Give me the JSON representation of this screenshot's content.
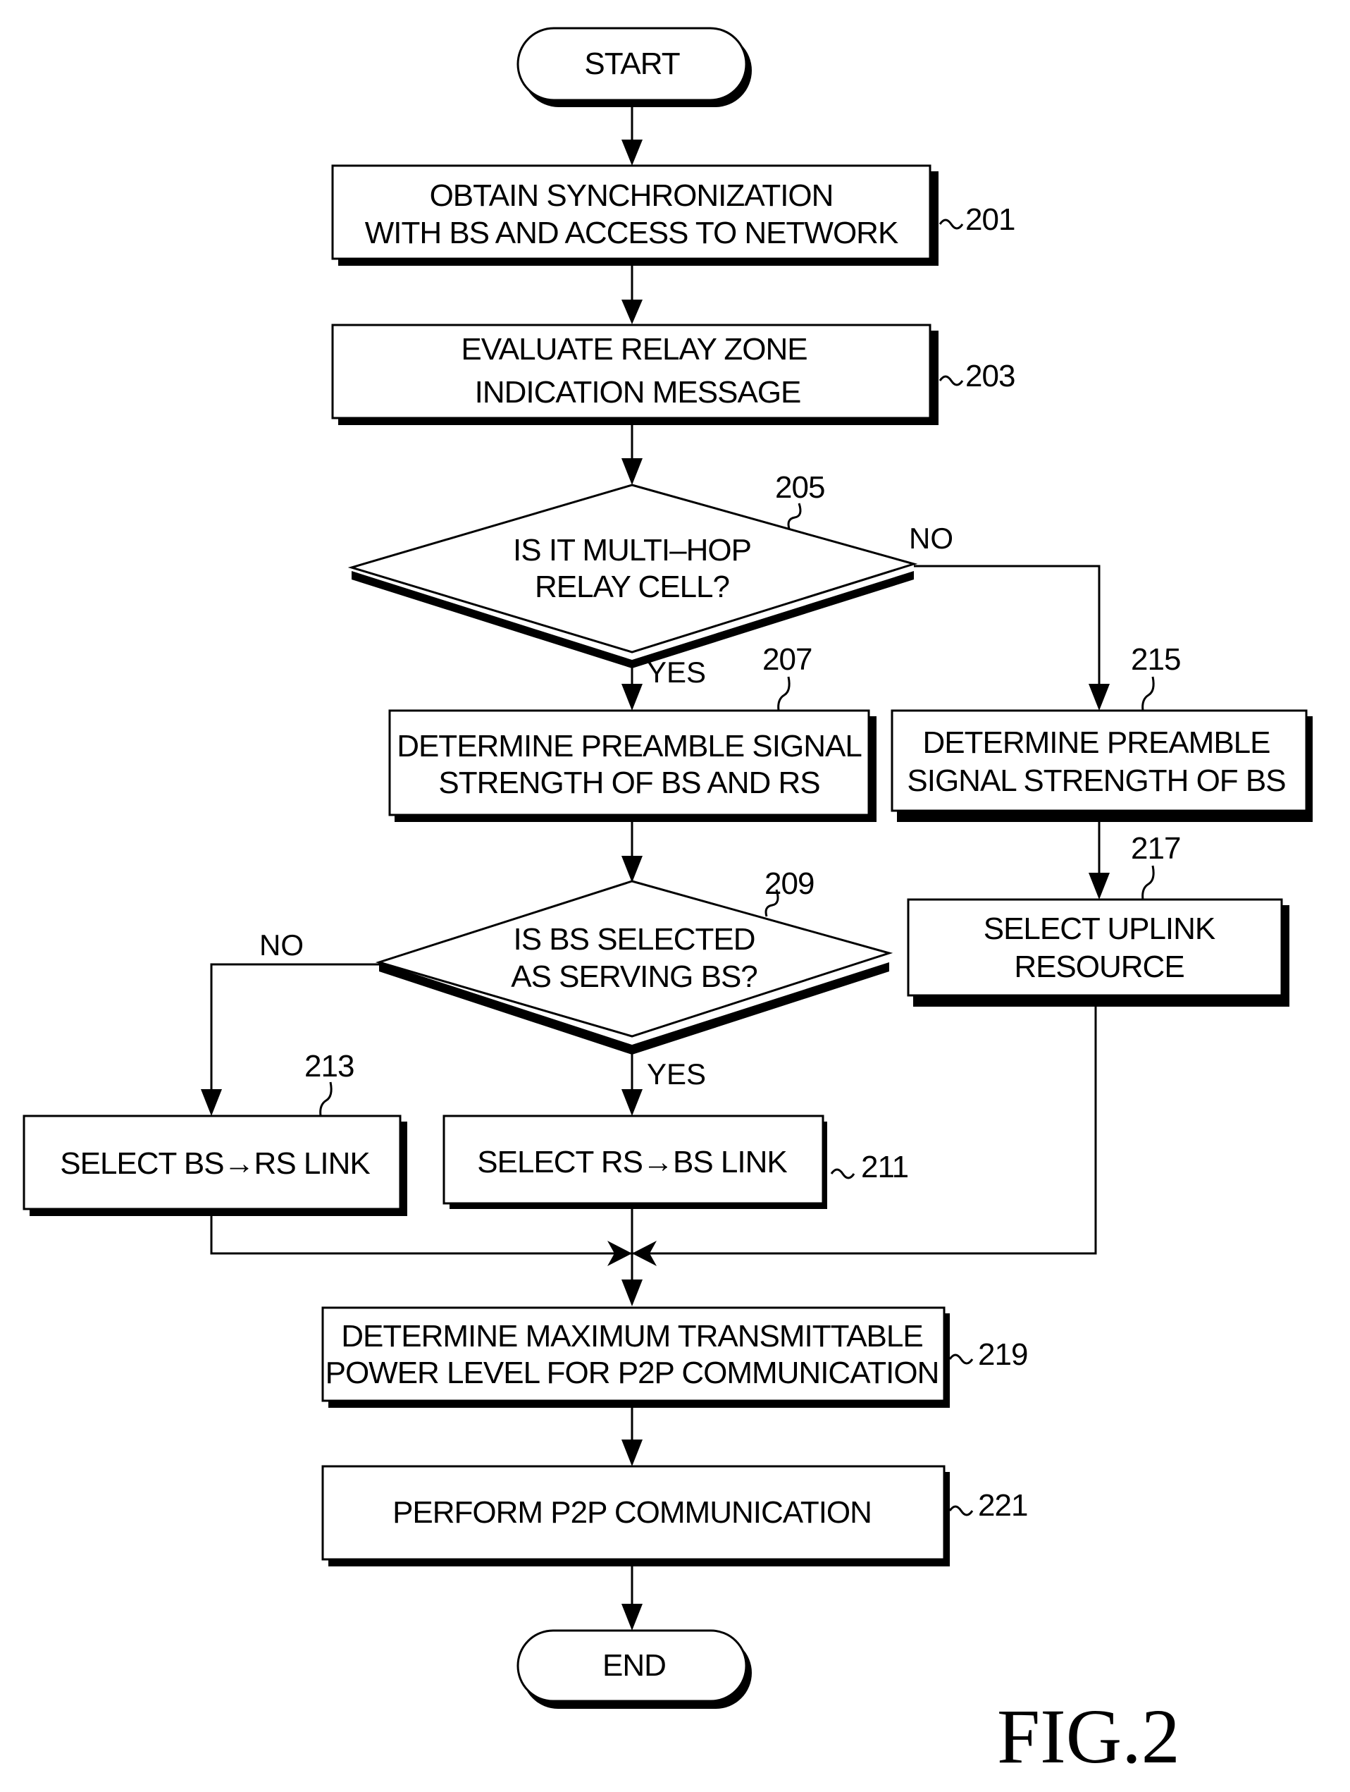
{
  "figure_label": "FIG.2",
  "terminals": {
    "start": "START",
    "end": "END"
  },
  "steps": {
    "s201": {
      "ref": "201",
      "lines": [
        "OBTAIN SYNCHRONIZATION",
        "WITH BS AND ACCESS TO NETWORK"
      ]
    },
    "s203": {
      "ref": "203",
      "lines": [
        "EVALUATE RELAY ZONE",
        "INDICATION MESSAGE"
      ]
    },
    "s205": {
      "ref": "205",
      "lines": [
        "IS IT MULTI–HOP",
        "RELAY CELL?"
      ],
      "yes": "YES",
      "no": "NO"
    },
    "s207": {
      "ref": "207",
      "lines": [
        "DETERMINE PREAMBLE SIGNAL",
        "STRENGTH OF BS AND RS"
      ]
    },
    "s209": {
      "ref": "209",
      "lines": [
        "IS BS SELECTED",
        "AS SERVING BS?"
      ],
      "yes": "YES",
      "no": "NO"
    },
    "s211": {
      "ref": "211",
      "lines": [
        "SELECT RS→BS LINK"
      ]
    },
    "s213": {
      "ref": "213",
      "lines": [
        "SELECT BS→RS LINK"
      ]
    },
    "s215": {
      "ref": "215",
      "lines": [
        "DETERMINE PREAMBLE",
        "SIGNAL STRENGTH OF BS"
      ]
    },
    "s217": {
      "ref": "217",
      "lines": [
        "SELECT UPLINK",
        "RESOURCE"
      ]
    },
    "s219": {
      "ref": "219",
      "lines": [
        "DETERMINE MAXIMUM TRANSMITTABLE",
        "POWER LEVEL FOR P2P COMMUNICATION"
      ]
    },
    "s221": {
      "ref": "221",
      "lines": [
        "PERFORM P2P COMMUNICATION"
      ]
    }
  }
}
